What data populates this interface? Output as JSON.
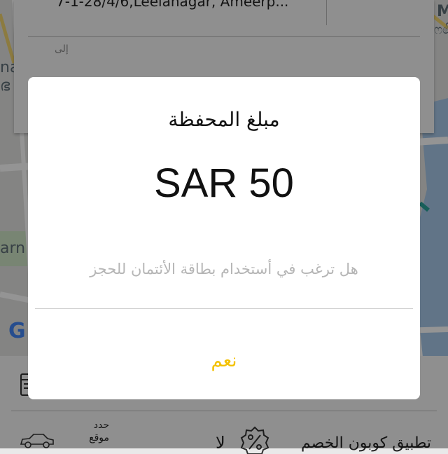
{
  "address_card": {
    "from_address": "7-1-28/4/6,Leelanagar, Ameerp...",
    "to_label": "إلى"
  },
  "map": {
    "label_left_top": "nay",
    "label_left_mid": "ഭ",
    "label_left_bottom": "arn",
    "label_right_top": "M",
    "label_right_second": "ෆ෯",
    "google_mark": "G",
    "colors": {
      "water": "#a8c8e8",
      "road": "#ffffff",
      "yellow_road": "#f2d46f",
      "green": "#cfe6c6"
    }
  },
  "bottom_panel": {
    "specify_location": "حدد موقع",
    "no_label": "لا",
    "coupon_label": "تطبيق كوبون الخصم",
    "icons": [
      "calendar-icon",
      "car-icon",
      "coupon-percent-icon"
    ]
  },
  "dialog": {
    "title": "مبلغ المحفظة",
    "amount": "SAR 50",
    "message": "هل ترغب في أستخدام بطاقة الأئتمان للحجز",
    "yes_button": "نعم",
    "accent_color": "#f3c100"
  }
}
